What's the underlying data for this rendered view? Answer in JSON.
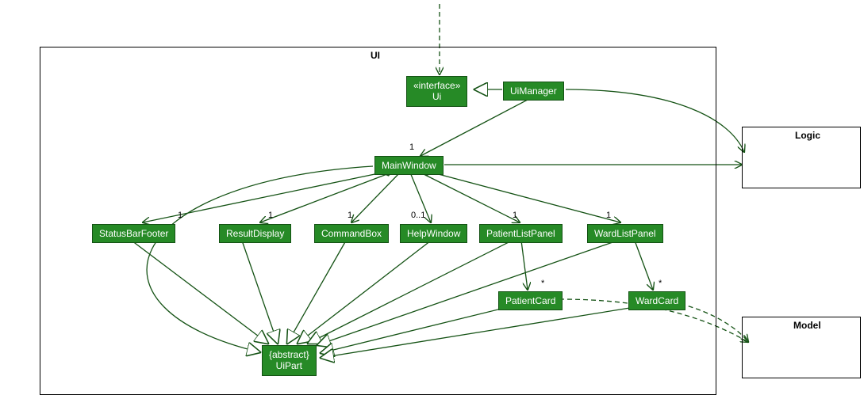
{
  "packages": {
    "ui": "UI",
    "logic": "Logic",
    "model": "Model"
  },
  "classes": {
    "ui_interface": {
      "stereotype": "«interface»",
      "name": "Ui"
    },
    "ui_manager": "UiManager",
    "main_window": "MainWindow",
    "status_bar": "StatusBarFooter",
    "result_display": "ResultDisplay",
    "command_box": "CommandBox",
    "help_window": "HelpWindow",
    "patient_list_panel": "PatientListPanel",
    "ward_list_panel": "WardListPanel",
    "patient_card": "PatientCard",
    "ward_card": "WardCard",
    "ui_part": {
      "stereotype": "{abstract}",
      "name": "UiPart"
    }
  },
  "multiplicities": {
    "mw": "1",
    "sb": "1",
    "rd": "1",
    "cb": "1",
    "hw": "0..1",
    "plp": "1",
    "wlp": "1",
    "pc": "*",
    "wc": "*"
  }
}
